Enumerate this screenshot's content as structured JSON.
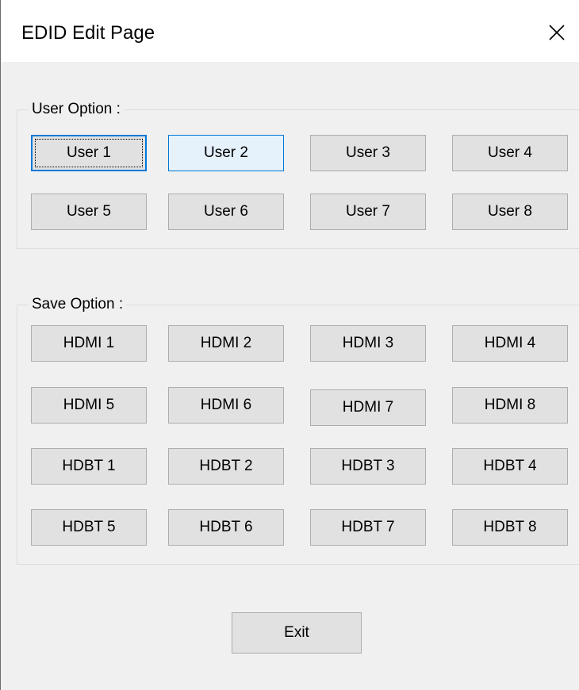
{
  "window": {
    "title": "EDID Edit Page",
    "close_icon": "close-icon"
  },
  "user_option": {
    "label": "User Option :",
    "buttons": [
      "User 1",
      "User 2",
      "User 3",
      "User 4",
      "User 5",
      "User 6",
      "User 7",
      "User 8"
    ],
    "focused": "User 1",
    "hovered": "User 2"
  },
  "save_option": {
    "label": "Save Option :",
    "buttons": [
      "HDMI 1",
      "HDMI 2",
      "HDMI 3",
      "HDMI 4",
      "HDMI 5",
      "HDMI 6",
      "HDMI 7",
      "HDMI 8",
      "HDBT 1",
      "HDBT 2",
      "HDBT 3",
      "HDBT 4",
      "HDBT 5",
      "HDBT 6",
      "HDBT 7",
      "HDBT 8"
    ]
  },
  "footer": {
    "exit_label": "Exit"
  },
  "colors": {
    "accent": "#0078d7",
    "button_face": "#e1e1e1",
    "hover_face": "#e5f1fb",
    "window_bg": "#f0f0f0"
  }
}
